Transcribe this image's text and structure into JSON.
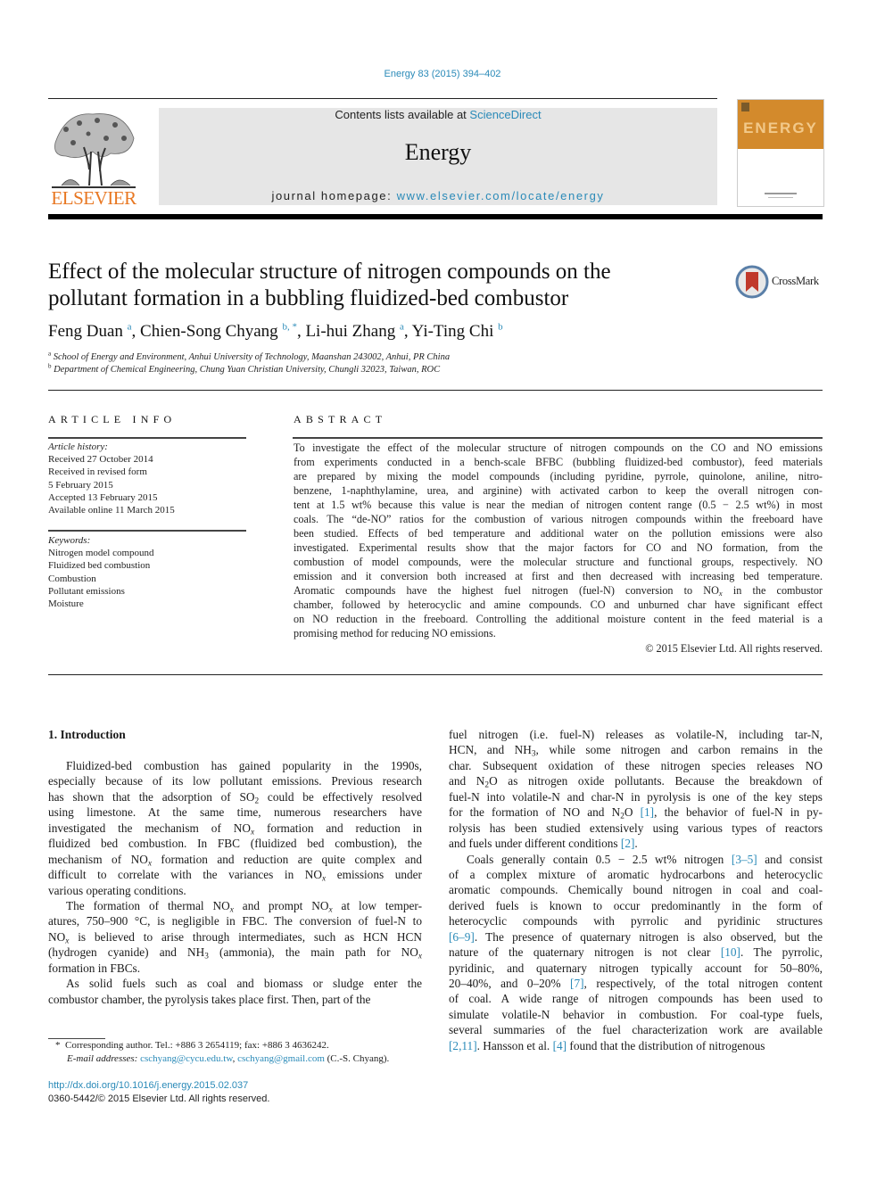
{
  "journal_ref": "Energy 83 (2015) 394–402",
  "banner": {
    "contents_prefix": "Contents lists available at ",
    "contents_link": "ScienceDirect",
    "journal_title": "Energy",
    "homepage_prefix": "journal homepage: ",
    "homepage_link": "www.elsevier.com/locate/energy"
  },
  "publisher_logo": "ELSEVIER",
  "cover_thumbnail": "ENERGY",
  "crossmark_label": "CrossMark",
  "colors": {
    "link": "#2a8ab8",
    "elsevier_orange": "#e87722",
    "banner_bg": "#e6e6e6",
    "cover_orange": "#d38a2c",
    "crossmark_red": "#c0392b"
  },
  "title": {
    "line1": "Effect of the molecular structure of nitrogen compounds on the",
    "line2": "pollutant formation in a bubbling fluidized-bed combustor"
  },
  "authors": [
    {
      "name": "Feng Duan",
      "sup": "a"
    },
    {
      "name": "Chien-Song Chyang",
      "sup": "b, *"
    },
    {
      "name": "Li-hui Zhang",
      "sup": "a"
    },
    {
      "name": "Yi-Ting Chi",
      "sup": "b"
    }
  ],
  "affiliations": [
    {
      "key": "a",
      "text": "School of Energy and Environment, Anhui University of Technology, Maanshan 243002, Anhui, PR China"
    },
    {
      "key": "b",
      "text": "Department of Chemical Engineering, Chung Yuan Christian University, Chungli 32023, Taiwan, ROC"
    }
  ],
  "article_info": {
    "heading": "ARTICLE INFO",
    "history_label": "Article history:",
    "history": [
      "Received 27 October 2014",
      "Received in revised form",
      "5 February 2015",
      "Accepted 13 February 2015",
      "Available online 11 March 2015"
    ],
    "keywords_label": "Keywords:",
    "keywords": [
      "Nitrogen model compound",
      "Fluidized bed combustion",
      "Combustion",
      "Pollutant emissions",
      "Moisture"
    ]
  },
  "abstract": {
    "heading": "ABSTRACT",
    "lines": [
      "To investigate the effect of the molecular structure of nitrogen compounds on the CO and NO emissions",
      "from experiments conducted in a bench-scale BFBC (bubbling fluidized-bed combustor), feed materials",
      "are prepared by mixing the model compounds (including pyridine, pyrrole, quinolone, aniline, nitro-",
      "benzene, 1-naphthylamine, urea, and arginine) with activated carbon to keep the overall nitrogen con-",
      "tent at 1.5 wt% because this value is near the median of nitrogen content range (0.5 − 2.5 wt%) in most",
      "coals. The “de-NO” ratios for the combustion of various nitrogen compounds within the freeboard have",
      "been studied. Effects of bed temperature and additional water on the pollution emissions were also",
      "investigated. Experimental results show that the major factors for CO and NO formation, from the",
      "combustion of model compounds, were the molecular structure and functional groups, respectively. NO",
      "emission and it conversion both increased at first and then decreased with increasing bed temperature.",
      "Aromatic compounds have the highest fuel nitrogen (fuel-N) conversion to NO",
      "chamber, followed by heterocyclic and amine compounds. CO and unburned char have significant effect",
      "on NO reduction in the freeboard. Controlling the additional moisture content in the feed material is a",
      "promising method for reducing NO emissions."
    ],
    "line11_sub": "x",
    "line11_tail": " in the combustor",
    "copyright": "© 2015 Elsevier Ltd. All rights reserved."
  },
  "intro": {
    "heading": "1.  Introduction",
    "left": {
      "p1": [
        "Fluidized-bed combustion has gained popularity in the 1990s,",
        "especially because of its low pollutant emissions. Previous research",
        [
          "has shown that the adsorption of SO",
          "2",
          " could be effectively resolved"
        ],
        "using limestone. At the same time, numerous researchers have",
        [
          "investigated the mechanism of NO",
          "x",
          " formation and reduction in"
        ],
        "fluidized bed combustion. In FBC (fluidized bed combustion), the",
        [
          "mechanism of NO",
          "x",
          " formation and reduction are quite complex and"
        ],
        [
          "difficult to correlate with the variances in NO",
          "x",
          " emissions under"
        ],
        "various operating conditions."
      ],
      "p2": [
        [
          "The formation of thermal NO",
          "x",
          " and prompt NO",
          "x",
          " at low temper-"
        ],
        "atures, 750–900 °C, is negligible in FBC. The conversion of fuel-N to",
        [
          "NO",
          "x",
          " is believed to arise through intermediates, such as HCN HCN"
        ],
        [
          "(hydrogen cyanide) and NH",
          "3",
          " (ammonia), the main path for NO",
          "x",
          ""
        ],
        "formation in FBCs."
      ],
      "p3": [
        "As solid fuels such as coal and biomass or sludge enter the",
        "combustor chamber, the pyrolysis takes place first. Then, part of the"
      ]
    },
    "right": {
      "p1": [
        "fuel nitrogen (i.e. fuel-N) releases as volatile-N, including tar-N,",
        [
          "HCN, and NH",
          "3",
          ", while some nitrogen and carbon remains in the"
        ],
        "char. Subsequent oxidation of these nitrogen species releases NO",
        [
          "and N",
          "2",
          "O as nitrogen oxide pollutants. Because the breakdown of"
        ],
        "fuel-N into volatile-N and char-N in pyrolysis is one of the key steps",
        [
          "for the formation of NO and N",
          "2",
          "O ",
          "[1]",
          ", the behavior of fuel-N in py-"
        ],
        "rolysis has been studied extensively using various types of reactors",
        [
          "and fuels under different conditions ",
          "[2]",
          "."
        ]
      ],
      "p2": [
        [
          "Coals generally contain 0.5 − 2.5 wt% nitrogen ",
          "[3–5]",
          " and consist"
        ],
        "of a complex mixture of aromatic hydrocarbons and heterocyclic",
        "aromatic compounds. Chemically bound nitrogen in coal and coal-",
        "derived fuels is known to occur predominantly in the form of",
        "heterocyclic compounds with pyrrolic and pyridinic structures",
        [
          "[6–9]",
          ". The presence of quaternary nitrogen is also observed, but the"
        ],
        [
          "nature of the quaternary nitrogen is not clear ",
          "[10]",
          ". The pyrrolic,"
        ],
        "pyridinic, and quaternary nitrogen typically account for 50–80%,",
        [
          "20–40%, and 0–20% ",
          "[7]",
          ", respectively, of the total nitrogen content"
        ],
        "of coal. A wide range of nitrogen compounds has been used to",
        "simulate volatile-N behavior in combustion. For coal-type fuels,",
        "several summaries of the fuel characterization work are available",
        [
          "[2,11]",
          ". Hansson et al. ",
          "[4]",
          " found that the distribution of nitrogenous"
        ]
      ]
    }
  },
  "footnote": {
    "marker": "*",
    "corresponding": "Corresponding author. Tel.: +886 3 2654119; fax: +886 3 4636242.",
    "email_label": "E-mail addresses:",
    "email1": "cschyang@cycu.edu.tw",
    "email2": "cschyang@gmail.com",
    "email_suffix": "(C.-S. Chyang)."
  },
  "doi": "http://dx.doi.org/10.1016/j.energy.2015.02.037",
  "issn_line": "0360-5442/© 2015 Elsevier Ltd. All rights reserved."
}
